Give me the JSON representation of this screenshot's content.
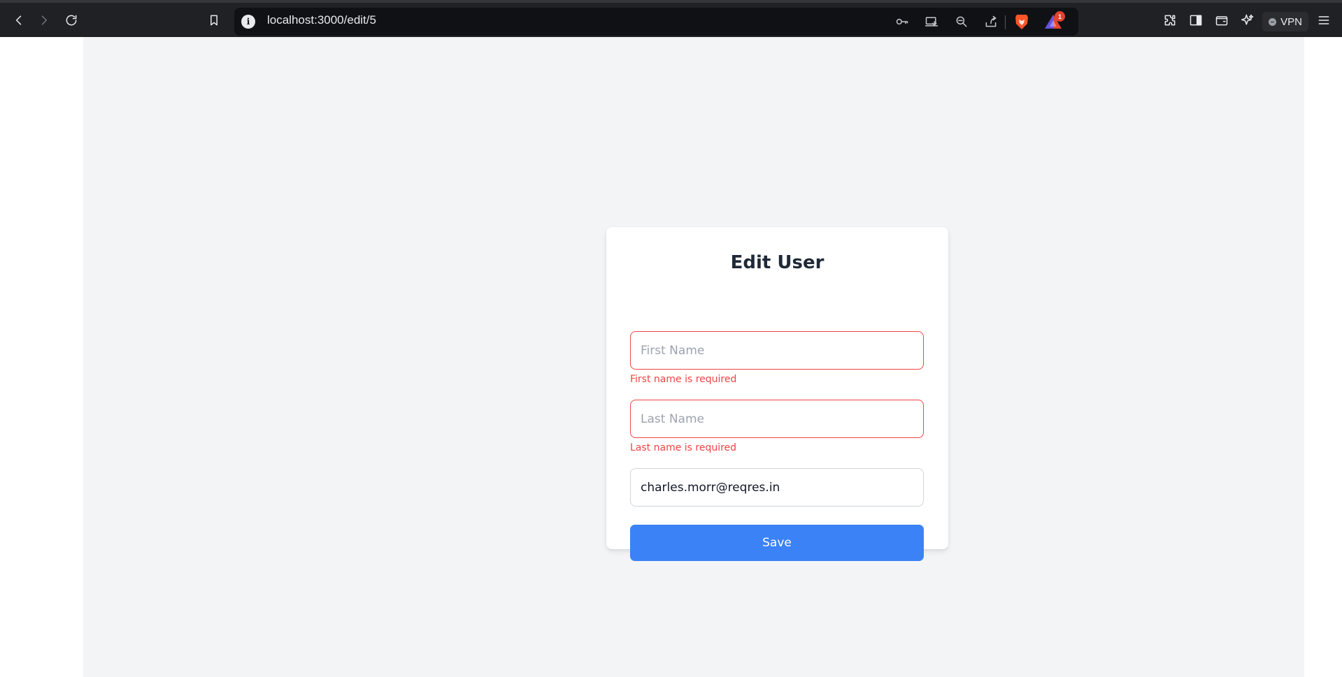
{
  "browser": {
    "url": "localhost:3000/edit/5",
    "notification_count": "1",
    "vpn_label": "VPN"
  },
  "form": {
    "title": "Edit User",
    "first_name": {
      "value": "",
      "placeholder": "First Name",
      "error": "First name is required"
    },
    "last_name": {
      "value": "",
      "placeholder": "Last Name",
      "error": "Last name is required"
    },
    "email": {
      "value": "charles.morr@reqres.in",
      "placeholder": ""
    },
    "save_label": "Save"
  },
  "colors": {
    "accent": "#3b82f6",
    "error": "#ef4444",
    "page_bg": "#f3f4f6",
    "toolbar_bg": "#202124"
  }
}
